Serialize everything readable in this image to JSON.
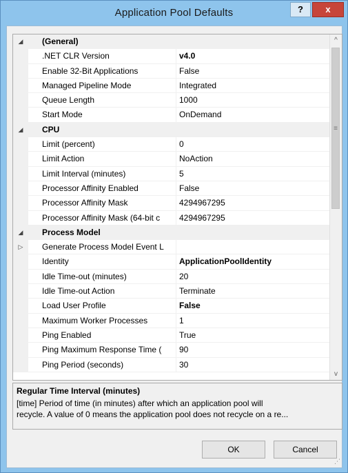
{
  "window": {
    "title": "Application Pool Defaults",
    "help_label": "?",
    "close_label": "x"
  },
  "grid": {
    "categories": [
      {
        "name": "(General)",
        "expand_glyph": "◢"
      },
      {
        "name": "CPU",
        "expand_glyph": "◢"
      },
      {
        "name": "Process Model",
        "expand_glyph": "◢"
      }
    ],
    "general": [
      {
        "name": ".NET CLR Version",
        "value": "v4.0"
      },
      {
        "name": "Enable 32-Bit Applications",
        "value": "False"
      },
      {
        "name": "Managed Pipeline Mode",
        "value": "Integrated"
      },
      {
        "name": "Queue Length",
        "value": "1000"
      },
      {
        "name": "Start Mode",
        "value": "OnDemand"
      }
    ],
    "cpu": [
      {
        "name": "Limit (percent)",
        "value": "0"
      },
      {
        "name": "Limit Action",
        "value": "NoAction"
      },
      {
        "name": "Limit Interval (minutes)",
        "value": "5"
      },
      {
        "name": "Processor Affinity Enabled",
        "value": "False"
      },
      {
        "name": "Processor Affinity Mask",
        "value": "4294967295"
      },
      {
        "name": "Processor Affinity Mask (64-bit c",
        "value": "4294967295"
      }
    ],
    "process_model": [
      {
        "name": "Generate Process Model Event L",
        "value": "",
        "expand_glyph": "▷"
      },
      {
        "name": "Identity",
        "value": "ApplicationPoolIdentity"
      },
      {
        "name": "Idle Time-out (minutes)",
        "value": "20"
      },
      {
        "name": "Idle Time-out Action",
        "value": "Terminate"
      },
      {
        "name": "Load User Profile",
        "value": "False"
      },
      {
        "name": "Maximum Worker Processes",
        "value": "1"
      },
      {
        "name": "Ping Enabled",
        "value": "True"
      },
      {
        "name": "Ping Maximum Response Time (",
        "value": "90"
      },
      {
        "name": "Ping Period (seconds)",
        "value": "30"
      }
    ],
    "scrollbar": {
      "up_glyph": "^",
      "down_glyph": "v",
      "grip_glyph": "≡"
    }
  },
  "description": {
    "title": "Regular Time Interval (minutes)",
    "line1": "[time] Period of time (in minutes) after which an application pool will",
    "line2": "recycle.  A value of 0 means the application pool does not recycle on a re..."
  },
  "buttons": {
    "ok": "OK",
    "cancel": "Cancel"
  },
  "colors": {
    "titlebar": "#8ec4ec",
    "close": "#c7453a"
  }
}
